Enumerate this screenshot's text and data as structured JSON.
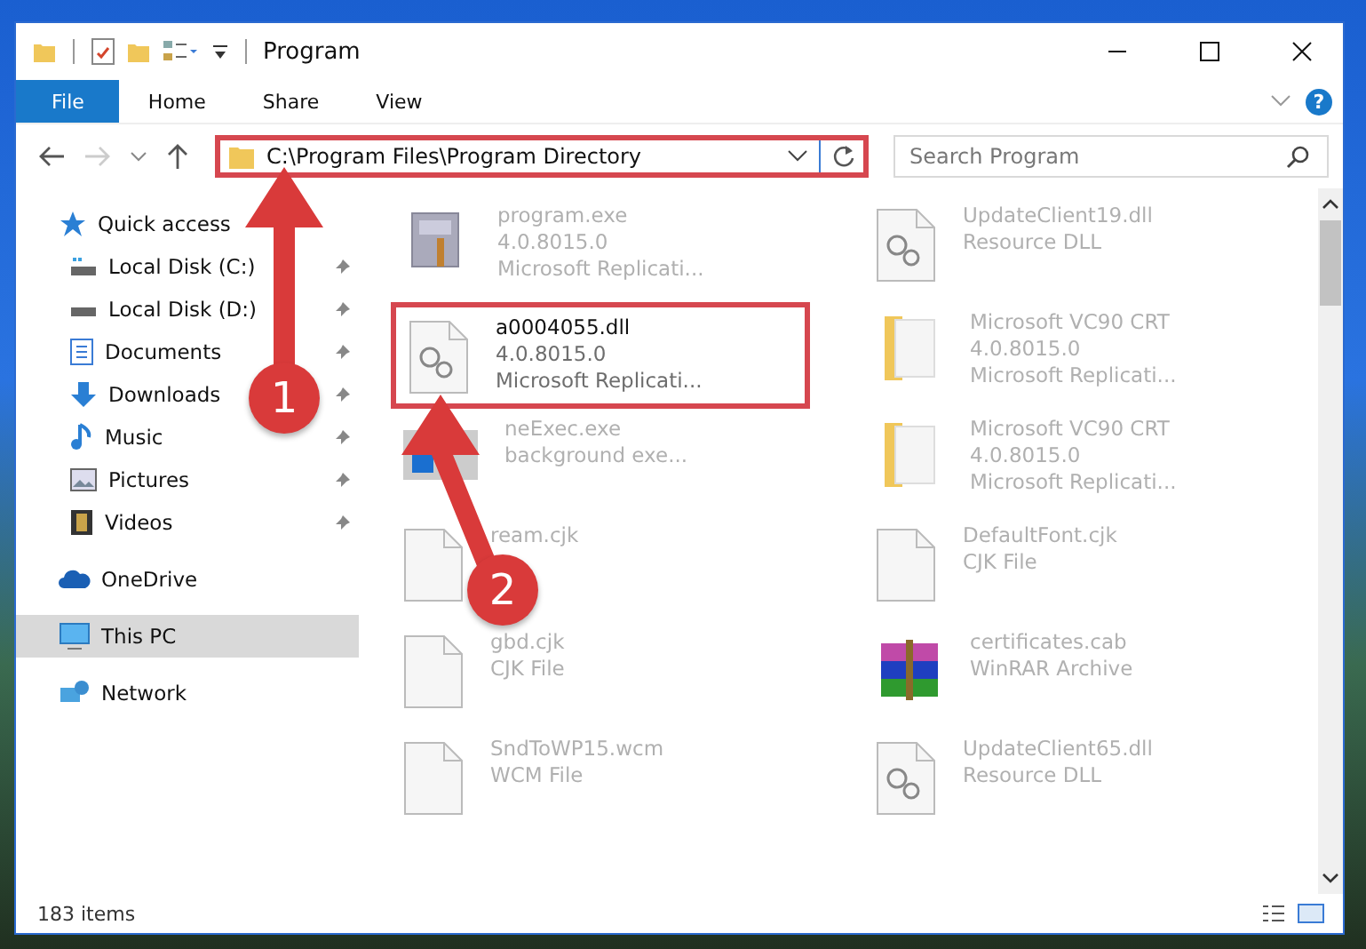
{
  "window": {
    "title": "Program"
  },
  "ribbon": {
    "tabs": [
      {
        "label": "File",
        "kind": "file",
        "selected": true
      },
      {
        "label": "Home",
        "kind": "tab",
        "selected": false
      },
      {
        "label": "Share",
        "kind": "tab",
        "selected": false
      },
      {
        "label": "View",
        "kind": "tab",
        "selected": false
      }
    ],
    "help": "?"
  },
  "address": {
    "path": "C:\\Program Files\\Program Directory",
    "highlighted": true
  },
  "search": {
    "placeholder": "Search Program"
  },
  "sidebar": {
    "items": [
      {
        "label": "Quick access",
        "selected": false,
        "children": [
          {
            "label": "Local Disk (C:)",
            "pinned": true,
            "selected": false
          },
          {
            "label": "Local Disk (D:)",
            "pinned": true,
            "selected": false
          },
          {
            "label": "Documents",
            "pinned": true,
            "selected": false
          },
          {
            "label": "Downloads",
            "pinned": true,
            "selected": false
          },
          {
            "label": "Music",
            "pinned": true,
            "selected": false
          },
          {
            "label": "Pictures",
            "pinned": true,
            "selected": false
          },
          {
            "label": "Videos",
            "pinned": true,
            "selected": false
          }
        ]
      },
      {
        "label": "OneDrive",
        "selected": false
      },
      {
        "label": "This PC",
        "selected": true
      },
      {
        "label": "Network",
        "selected": false
      }
    ]
  },
  "files": [
    {
      "name": "program.exe",
      "lines": [
        "4.0.8015.0",
        "Microsoft Replicati..."
      ],
      "kind": "app",
      "highlighted": false
    },
    {
      "name": "UpdateClient19.dll",
      "lines": [
        "Resource DLL"
      ],
      "kind": "dll",
      "highlighted": false
    },
    {
      "name": "a0004055.dll",
      "lines": [
        "4.0.8015.0",
        "Microsoft Replicati..."
      ],
      "kind": "dll",
      "highlighted": true
    },
    {
      "name": "Microsoft VC90 CRT",
      "lines": [
        "4.0.8015.0",
        "Microsoft Replicati..."
      ],
      "kind": "manifest",
      "highlighted": false
    },
    {
      "name": "neExec.exe",
      "lines": [
        "background exe..."
      ],
      "kind": "window",
      "highlighted": false
    },
    {
      "name": "Microsoft VC90 CRT",
      "lines": [
        "4.0.8015.0",
        "Microsoft Replicati..."
      ],
      "kind": "manifest",
      "highlighted": false
    },
    {
      "name": "ream.cjk",
      "kind": "blank",
      "highlighted": false
    },
    {
      "name": "DefaultFont.cjk",
      "lines": [
        "CJK File"
      ],
      "kind": "blank",
      "highlighted": false
    },
    {
      "name": "gbd.cjk",
      "lines": [
        "CJK File"
      ],
      "kind": "blank",
      "highlighted": false
    },
    {
      "name": "certificates.cab",
      "lines": [
        "WinRAR Archive"
      ],
      "kind": "archive",
      "highlighted": false
    },
    {
      "name": "SndToWP15.wcm",
      "lines": [
        "WCM File"
      ],
      "kind": "blank",
      "highlighted": false
    },
    {
      "name": "UpdateClient65.dll",
      "lines": [
        "Resource DLL"
      ],
      "kind": "dll",
      "highlighted": false
    }
  ],
  "status_bar": {
    "count": "183 items"
  },
  "callouts": [
    {
      "number": "1"
    },
    {
      "number": "2"
    }
  ]
}
